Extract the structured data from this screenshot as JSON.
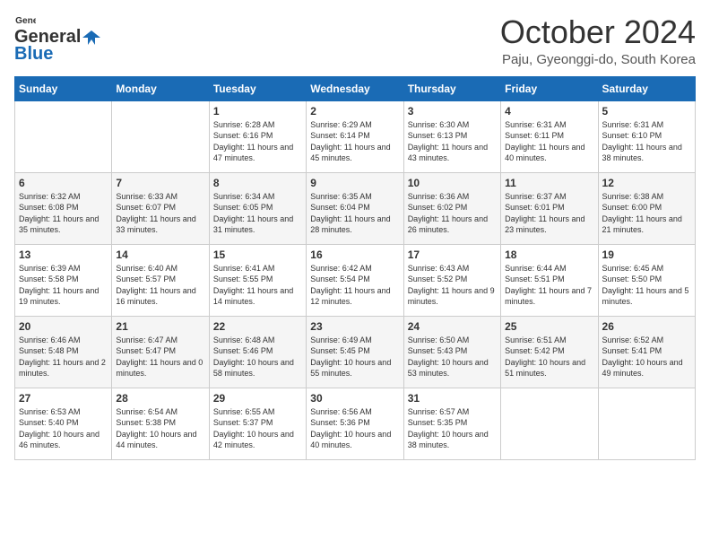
{
  "header": {
    "logo_general": "General",
    "logo_blue": "Blue",
    "month": "October 2024",
    "location": "Paju, Gyeonggi-do, South Korea"
  },
  "weekdays": [
    "Sunday",
    "Monday",
    "Tuesday",
    "Wednesday",
    "Thursday",
    "Friday",
    "Saturday"
  ],
  "weeks": [
    [
      {
        "day": "",
        "info": ""
      },
      {
        "day": "",
        "info": ""
      },
      {
        "day": "1",
        "info": "Sunrise: 6:28 AM\nSunset: 6:16 PM\nDaylight: 11 hours and 47 minutes."
      },
      {
        "day": "2",
        "info": "Sunrise: 6:29 AM\nSunset: 6:14 PM\nDaylight: 11 hours and 45 minutes."
      },
      {
        "day": "3",
        "info": "Sunrise: 6:30 AM\nSunset: 6:13 PM\nDaylight: 11 hours and 43 minutes."
      },
      {
        "day": "4",
        "info": "Sunrise: 6:31 AM\nSunset: 6:11 PM\nDaylight: 11 hours and 40 minutes."
      },
      {
        "day": "5",
        "info": "Sunrise: 6:31 AM\nSunset: 6:10 PM\nDaylight: 11 hours and 38 minutes."
      }
    ],
    [
      {
        "day": "6",
        "info": "Sunrise: 6:32 AM\nSunset: 6:08 PM\nDaylight: 11 hours and 35 minutes."
      },
      {
        "day": "7",
        "info": "Sunrise: 6:33 AM\nSunset: 6:07 PM\nDaylight: 11 hours and 33 minutes."
      },
      {
        "day": "8",
        "info": "Sunrise: 6:34 AM\nSunset: 6:05 PM\nDaylight: 11 hours and 31 minutes."
      },
      {
        "day": "9",
        "info": "Sunrise: 6:35 AM\nSunset: 6:04 PM\nDaylight: 11 hours and 28 minutes."
      },
      {
        "day": "10",
        "info": "Sunrise: 6:36 AM\nSunset: 6:02 PM\nDaylight: 11 hours and 26 minutes."
      },
      {
        "day": "11",
        "info": "Sunrise: 6:37 AM\nSunset: 6:01 PM\nDaylight: 11 hours and 23 minutes."
      },
      {
        "day": "12",
        "info": "Sunrise: 6:38 AM\nSunset: 6:00 PM\nDaylight: 11 hours and 21 minutes."
      }
    ],
    [
      {
        "day": "13",
        "info": "Sunrise: 6:39 AM\nSunset: 5:58 PM\nDaylight: 11 hours and 19 minutes."
      },
      {
        "day": "14",
        "info": "Sunrise: 6:40 AM\nSunset: 5:57 PM\nDaylight: 11 hours and 16 minutes."
      },
      {
        "day": "15",
        "info": "Sunrise: 6:41 AM\nSunset: 5:55 PM\nDaylight: 11 hours and 14 minutes."
      },
      {
        "day": "16",
        "info": "Sunrise: 6:42 AM\nSunset: 5:54 PM\nDaylight: 11 hours and 12 minutes."
      },
      {
        "day": "17",
        "info": "Sunrise: 6:43 AM\nSunset: 5:52 PM\nDaylight: 11 hours and 9 minutes."
      },
      {
        "day": "18",
        "info": "Sunrise: 6:44 AM\nSunset: 5:51 PM\nDaylight: 11 hours and 7 minutes."
      },
      {
        "day": "19",
        "info": "Sunrise: 6:45 AM\nSunset: 5:50 PM\nDaylight: 11 hours and 5 minutes."
      }
    ],
    [
      {
        "day": "20",
        "info": "Sunrise: 6:46 AM\nSunset: 5:48 PM\nDaylight: 11 hours and 2 minutes."
      },
      {
        "day": "21",
        "info": "Sunrise: 6:47 AM\nSunset: 5:47 PM\nDaylight: 11 hours and 0 minutes."
      },
      {
        "day": "22",
        "info": "Sunrise: 6:48 AM\nSunset: 5:46 PM\nDaylight: 10 hours and 58 minutes."
      },
      {
        "day": "23",
        "info": "Sunrise: 6:49 AM\nSunset: 5:45 PM\nDaylight: 10 hours and 55 minutes."
      },
      {
        "day": "24",
        "info": "Sunrise: 6:50 AM\nSunset: 5:43 PM\nDaylight: 10 hours and 53 minutes."
      },
      {
        "day": "25",
        "info": "Sunrise: 6:51 AM\nSunset: 5:42 PM\nDaylight: 10 hours and 51 minutes."
      },
      {
        "day": "26",
        "info": "Sunrise: 6:52 AM\nSunset: 5:41 PM\nDaylight: 10 hours and 49 minutes."
      }
    ],
    [
      {
        "day": "27",
        "info": "Sunrise: 6:53 AM\nSunset: 5:40 PM\nDaylight: 10 hours and 46 minutes."
      },
      {
        "day": "28",
        "info": "Sunrise: 6:54 AM\nSunset: 5:38 PM\nDaylight: 10 hours and 44 minutes."
      },
      {
        "day": "29",
        "info": "Sunrise: 6:55 AM\nSunset: 5:37 PM\nDaylight: 10 hours and 42 minutes."
      },
      {
        "day": "30",
        "info": "Sunrise: 6:56 AM\nSunset: 5:36 PM\nDaylight: 10 hours and 40 minutes."
      },
      {
        "day": "31",
        "info": "Sunrise: 6:57 AM\nSunset: 5:35 PM\nDaylight: 10 hours and 38 minutes."
      },
      {
        "day": "",
        "info": ""
      },
      {
        "day": "",
        "info": ""
      }
    ]
  ]
}
